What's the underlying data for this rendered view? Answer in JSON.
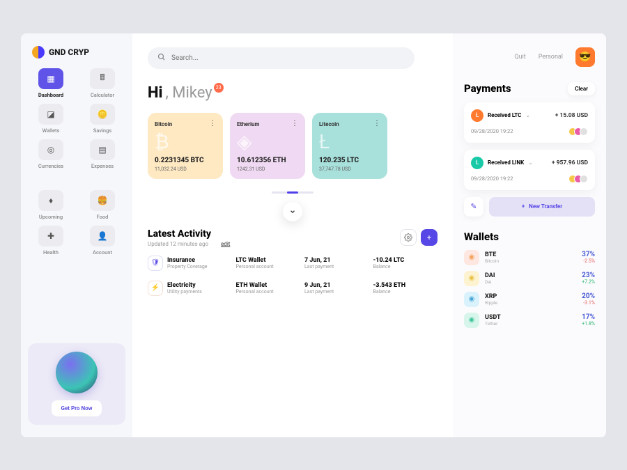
{
  "brand": "GND CRYP",
  "nav": [
    {
      "label": "Dashboard",
      "active": true,
      "icon": "grid-icon"
    },
    {
      "label": "Calculator",
      "active": false,
      "icon": "calculator-icon"
    },
    {
      "label": "Wallets",
      "active": false,
      "icon": "wallet-icon"
    },
    {
      "label": "Savings",
      "active": false,
      "icon": "savings-icon"
    },
    {
      "label": "Currencies",
      "active": false,
      "icon": "currency-icon"
    },
    {
      "label": "Expenses",
      "active": false,
      "icon": "expenses-icon"
    },
    {
      "label": "Upcoming",
      "active": false,
      "icon": "upcoming-icon"
    },
    {
      "label": "Food",
      "active": false,
      "icon": "food-icon"
    },
    {
      "label": "Health",
      "active": false,
      "icon": "health-icon"
    },
    {
      "label": "Account",
      "active": false,
      "icon": "account-icon"
    }
  ],
  "promo_cta": "Get Pro Now",
  "search_placeholder": "Search...",
  "greeting_hi": "Hi",
  "greeting_name": ", Mikey",
  "badge_count": "23",
  "coins": [
    {
      "name": "Bitcoin",
      "amount": "0.2231345 BTC",
      "usd": "11,032.24 USD",
      "class": "btc",
      "symbol": "₿"
    },
    {
      "name": "Etherium",
      "amount": "10.612356 ETH",
      "usd": "1242.31 USD",
      "class": "eth",
      "symbol": "◈"
    },
    {
      "name": "Litecoin",
      "amount": "120.235 LTC",
      "usd": "37,747.78 USD",
      "class": "ltc",
      "symbol": "Ł"
    }
  ],
  "activity": {
    "title": "Latest Activity",
    "subtitle": "Updated 12 minutes ago",
    "edit": "edit",
    "rows": [
      {
        "icon": "ins",
        "title": "Insurance",
        "sub": "Property Coverage",
        "wallet": "LTC Wallet",
        "wallet_sub": "Personal account",
        "date": "7 Jun, 21",
        "date_sub": "Last payment",
        "balance": "-10.24 LTC",
        "balance_sub": "Balance"
      },
      {
        "icon": "elec",
        "title": "Electricity",
        "sub": "Utility payments",
        "wallet": "ETH Wallet",
        "wallet_sub": "Personal account",
        "date": "9 Jun, 21",
        "date_sub": "Last payment",
        "balance": "-3.543 ETH",
        "balance_sub": "Balance"
      }
    ]
  },
  "top_links": {
    "quit": "Quit",
    "personal": "Personal"
  },
  "payments": {
    "title": "Payments",
    "clear": "Clear",
    "items": [
      {
        "label": "Received LTC",
        "amount": "+ 15.08 USD",
        "date": "09/28/2020 19:22",
        "color": "#ff7a2e"
      },
      {
        "label": "Received LINK",
        "amount": "+ 957.96 USD",
        "date": "09/28/2020 19:22",
        "color": "#18c9a7"
      }
    ],
    "new_transfer": "New Transfer"
  },
  "wallets_section": {
    "title": "Wallets",
    "items": [
      {
        "sym": "BTE",
        "name": "Bitcoin",
        "pct": "37%",
        "change": "-2.5%",
        "pos": false,
        "bg": "#fde7e0",
        "fg": "#f5a05a"
      },
      {
        "sym": "DAI",
        "name": "Dai",
        "pct": "23%",
        "change": "+7.2%",
        "pos": true,
        "bg": "#fdf3d0",
        "fg": "#e8c142"
      },
      {
        "sym": "XRP",
        "name": "Ripple",
        "pct": "20%",
        "change": "-3.1%",
        "pos": false,
        "bg": "#d9f2fb",
        "fg": "#4aa8d8"
      },
      {
        "sym": "USDT",
        "name": "Tether",
        "pct": "17%",
        "change": "+1.8%",
        "pos": true,
        "bg": "#d8f5ec",
        "fg": "#3cc49a"
      }
    ]
  }
}
